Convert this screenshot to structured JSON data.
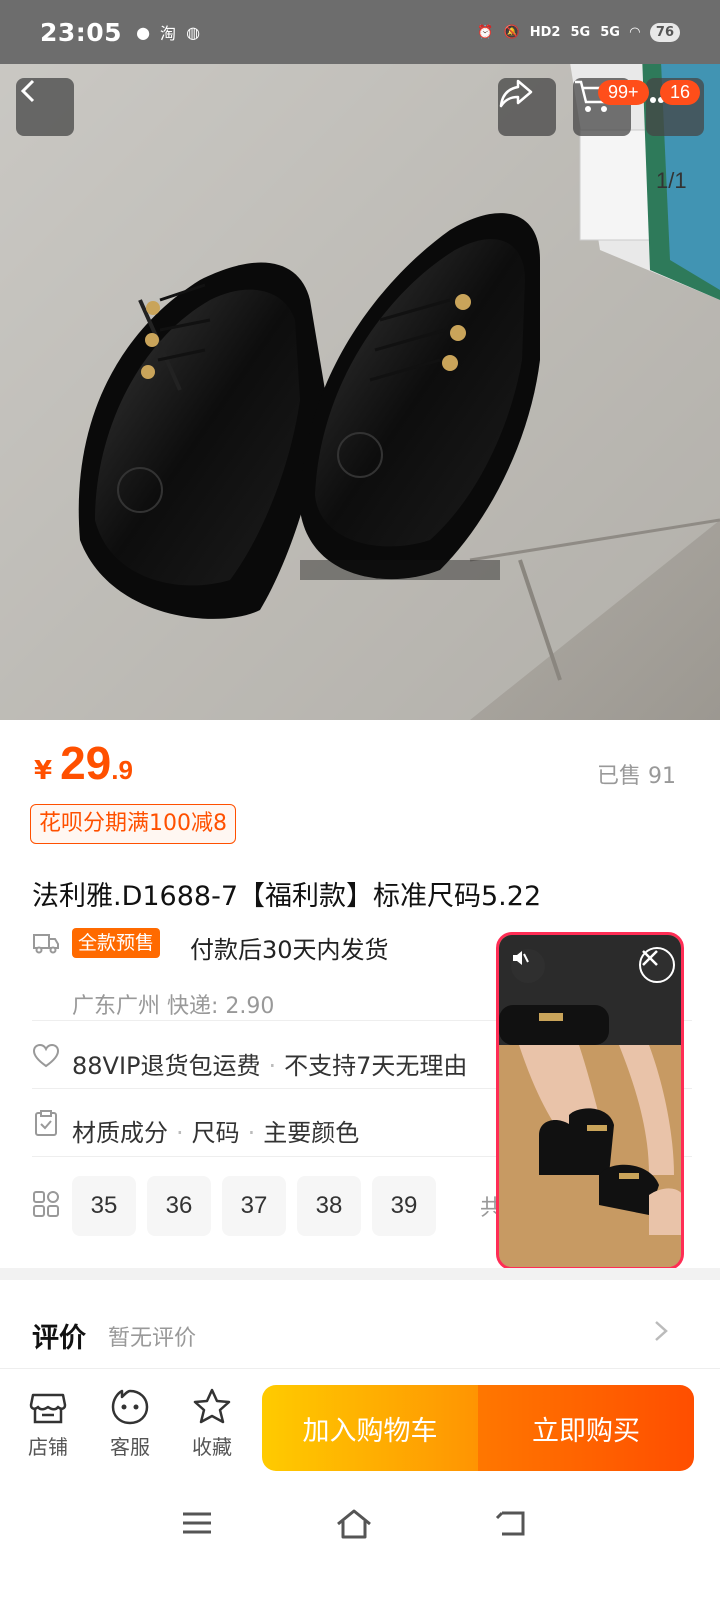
{
  "status_bar": {
    "time": "23:05",
    "app_icons": [
      "chat-bubble-icon",
      "taobao-icon",
      "wechat-icon"
    ],
    "indicators": [
      "alarm-icon",
      "mute-icon",
      "HD2",
      "5G",
      "5G",
      "wifi-icon"
    ],
    "battery": "76"
  },
  "hero": {
    "cart_badge": "99+",
    "message_badge": "16",
    "page_indicator": "1/1"
  },
  "product": {
    "price_symbol": "¥",
    "price_int": "29",
    "price_dec": ".9",
    "sold": "已售 91",
    "promo": "花呗分期满100减8",
    "title": "法利雅.D1688-7【福利款】标准尺码5.22"
  },
  "shipping": {
    "tag": "全款预售",
    "text": "付款后30天内发货",
    "sub": "广东广州  快递: 2.90"
  },
  "service": {
    "item1": "88VIP退货包运费",
    "item2": "不支持7天无理由"
  },
  "specs": {
    "item1": "材质成分",
    "item2": "尺码",
    "item3": "主要颜色"
  },
  "sizes": [
    "35",
    "36",
    "37",
    "38",
    "39"
  ],
  "sizes_more": "共",
  "review": {
    "label": "评价",
    "sub": "暂无评价"
  },
  "bottom_bar": {
    "store": "店铺",
    "service": "客服",
    "favorite": "收藏",
    "add_cart": "加入购物车",
    "buy_now": "立即购买"
  },
  "colors": {
    "accent": "#ff5000",
    "cart_btn": "#ffb300",
    "buy_btn": "#ff5a00",
    "video_border": "#ff2d55"
  }
}
